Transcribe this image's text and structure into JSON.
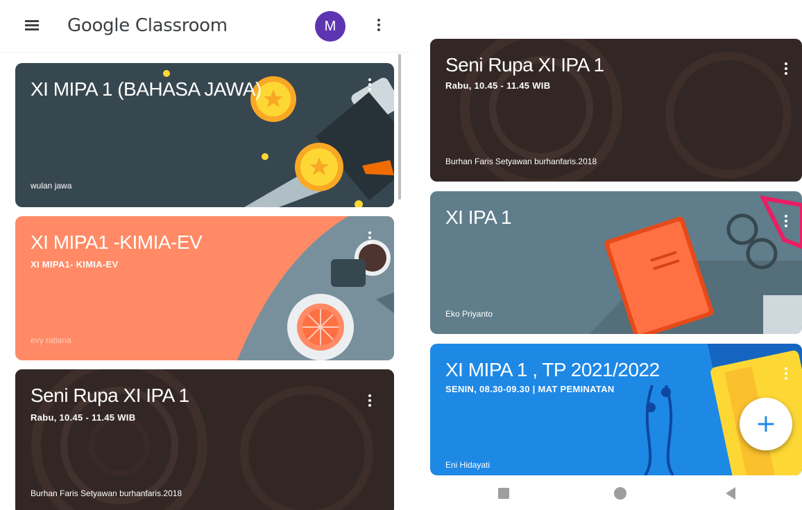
{
  "app": {
    "title": "Google Classroom",
    "avatar_initial": "M"
  },
  "colors": {
    "accent": "#5e35b1",
    "fab_plus": "#1e88e5"
  },
  "fab": {
    "label": "+"
  },
  "cards_left": [
    {
      "title": "XI MIPA 1 (BAHASA JAWA)",
      "subtitle": "",
      "teacher": "wulan jawa",
      "color": "#37474f"
    },
    {
      "title": "XI MIPA1 -KIMIA-EV",
      "subtitle": "XI MIPA1- KIMIA-EV",
      "teacher": "evy ratiana",
      "color": "#ff8a65"
    },
    {
      "title": "Seni Rupa XI IPA 1",
      "subtitle": "Rabu, 10.45 - 11.45 WIB",
      "teacher": "Burhan Faris Setyawan burhanfaris.2018",
      "color": "#3e2723"
    }
  ],
  "cards_right": [
    {
      "title": "Seni Rupa XI IPA 1",
      "subtitle": "Rabu, 10.45 - 11.45 WIB",
      "teacher": "Burhan Faris Setyawan burhanfaris.2018",
      "color": "#3e2723"
    },
    {
      "title": "XI IPA 1",
      "subtitle": "",
      "teacher": "Eko Priyanto",
      "color": "#607d8b"
    },
    {
      "title": "XI MIPA 1 , TP 2021/2022",
      "subtitle": "SENIN, 08.30-09.30 | MAT PEMINATAN",
      "teacher": "Eni Hidayati",
      "color": "#1e88e5"
    }
  ],
  "icons": {
    "menu": "hamburger-icon",
    "more": "more-vert-icon",
    "fab": "plus-icon",
    "nav": [
      "square-recents-icon",
      "circle-home-icon",
      "triangle-back-icon"
    ]
  }
}
